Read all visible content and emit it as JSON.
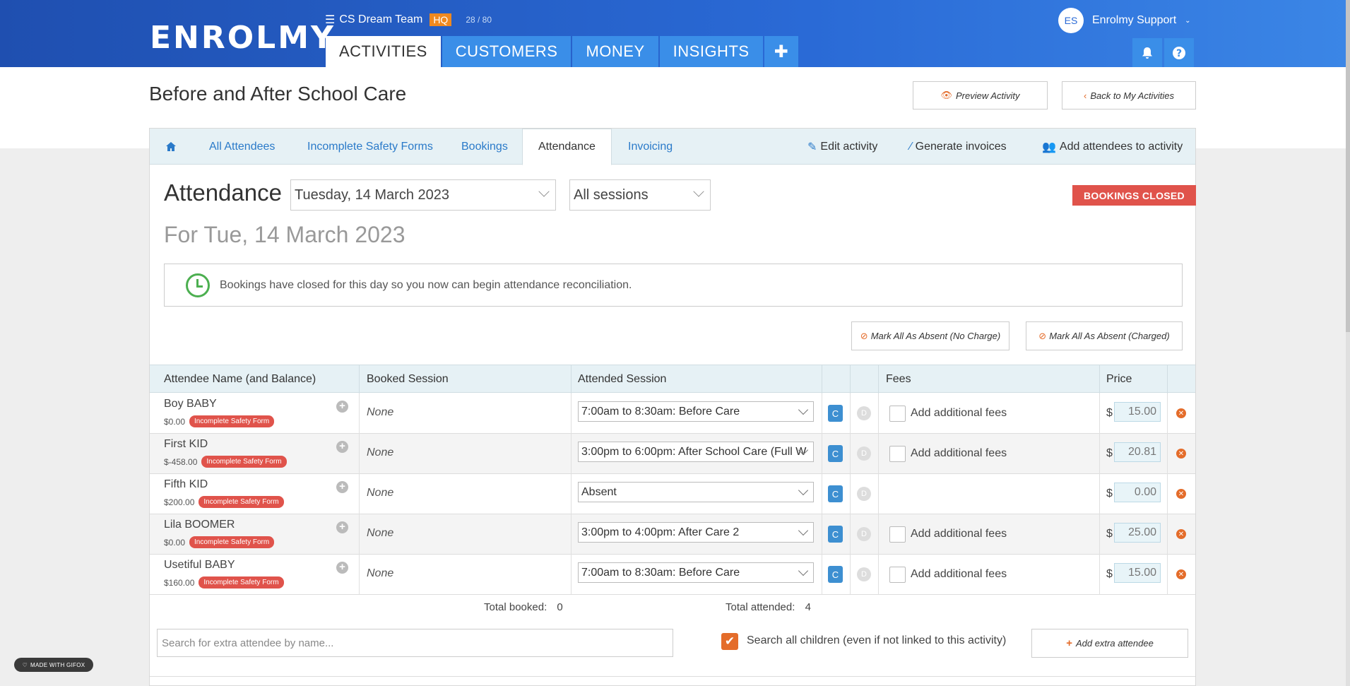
{
  "nav": {
    "logo": "ENROLMY",
    "team_name": "CS Dream Team",
    "team_badge": "HQ",
    "count": "28 / 80",
    "tabs": [
      {
        "label": "ACTIVITIES",
        "active": true
      },
      {
        "label": "CUSTOMERS",
        "active": false
      },
      {
        "label": "MONEY",
        "active": false
      },
      {
        "label": "INSIGHTS",
        "active": false
      }
    ],
    "plus": "✚",
    "user_initials": "ES",
    "user_name": "Enrolmy Support"
  },
  "page": {
    "title": "Before and After School Care",
    "preview_label": "Preview Activity",
    "back_label": "Back to My Activities"
  },
  "subnav": {
    "home_icon": "home-icon",
    "items": [
      "All Attendees",
      "Incomplete Safety Forms",
      "Bookings",
      "Attendance",
      "Invoicing"
    ],
    "active": "Attendance",
    "right_items": [
      "Edit activity",
      "Generate invoices",
      "Add attendees to activity"
    ]
  },
  "attendance": {
    "title": "Attendance",
    "date_value": "Tuesday, 14 March 2023",
    "session_value": "All sessions",
    "status_badge": "BOOKINGS  CLOSED",
    "for_date": "For Tue, 14 March 2023",
    "notice": "Bookings have closed for this day so you now can begin attendance reconciliation.",
    "absent_no_charge": "Mark All As Absent (No Charge)",
    "absent_charged": "Mark All As Absent (Charged)"
  },
  "table": {
    "headers": {
      "name": "Attendee Name (and Balance)",
      "booked": "Booked Session",
      "attended": "Attended Session",
      "fees": "Fees",
      "price": "Price"
    },
    "rows": [
      {
        "name": "Boy BABY",
        "balance": "$0.00",
        "tag": "Incomplete Safety Form",
        "booked": "None",
        "attended": "7:00am to 8:30am: Before Care",
        "fees_label": "Add additional fees",
        "price": "15.00"
      },
      {
        "name": "First KID",
        "balance": "$-458.00",
        "tag": "Incomplete Safety Form",
        "booked": "None",
        "attended": "3:00pm to 6:00pm: After School Care (Full W",
        "fees_label": "Add additional fees",
        "price": "20.81"
      },
      {
        "name": "Fifth KID",
        "balance": "$200.00",
        "tag": "Incomplete Safety Form",
        "booked": "None",
        "attended": "Absent",
        "fees_label": "",
        "price": "0.00"
      },
      {
        "name": "Lila BOOMER",
        "balance": "$0.00",
        "tag": "Incomplete Safety Form",
        "booked": "None",
        "attended": "3:00pm to 4:00pm: After Care 2",
        "fees_label": "Add additional fees",
        "price": "25.00"
      },
      {
        "name": "Usetiful BABY",
        "balance": "$160.00",
        "tag": "Incomplete Safety Form",
        "booked": "None",
        "attended": "7:00am to 8:30am: Before Care",
        "fees_label": "Add additional fees",
        "price": "15.00"
      }
    ],
    "c_label": "C",
    "d_label": "D",
    "currency": "$"
  },
  "totals": {
    "booked_label": "Total booked:",
    "booked_value": "0",
    "attended_label": "Total attended:",
    "attended_value": "4"
  },
  "extra": {
    "search_placeholder": "Search for extra attendee by name...",
    "search_all_label": "Search all children (even if not linked to this activity)",
    "add_label": "Add extra attendee"
  },
  "watermark": "MADE WITH GIFOX",
  "colors": {
    "brand_blue": "#2a6ad6",
    "accent_orange": "#e46c2a",
    "danger_red": "#e0534b",
    "link_blue": "#2a7ac9"
  }
}
